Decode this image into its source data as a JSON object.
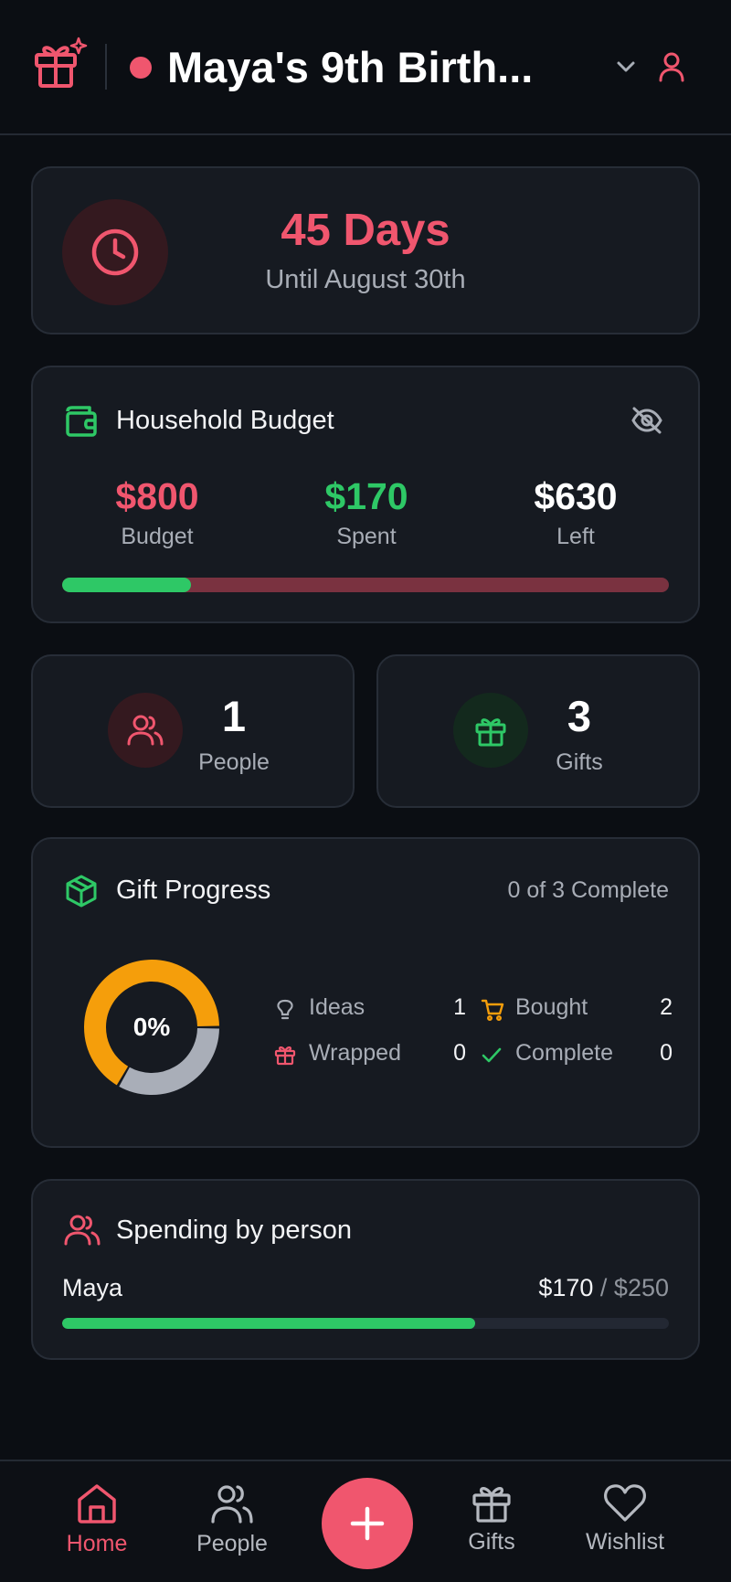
{
  "header": {
    "event_title": "Maya's 9th Birth...",
    "event_color": "#f0566e"
  },
  "countdown": {
    "days": "45 Days",
    "until": "Until August 30th"
  },
  "budget": {
    "title": "Household Budget",
    "budget_value": "$800",
    "budget_label": "Budget",
    "spent_value": "$170",
    "spent_label": "Spent",
    "left_value": "$630",
    "left_label": "Left",
    "spent_fraction": 0.2125
  },
  "stats": {
    "people_count": "1",
    "people_label": "People",
    "gifts_count": "3",
    "gifts_label": "Gifts"
  },
  "gift_progress": {
    "title": "Gift Progress",
    "summary": "0 of 3 Complete",
    "percent_label": "0%",
    "legend": [
      {
        "name": "Ideas",
        "value": "1",
        "icon": "lightbulb-icon"
      },
      {
        "name": "Bought",
        "value": "2",
        "icon": "cart-icon"
      },
      {
        "name": "Wrapped",
        "value": "0",
        "icon": "gift-icon"
      },
      {
        "name": "Complete",
        "value": "0",
        "icon": "check-icon"
      }
    ],
    "donut_segments": [
      {
        "status": "Ideas",
        "count": 1,
        "color": "#a9aeb8"
      },
      {
        "status": "Bought",
        "count": 2,
        "color": "#f59e0b"
      }
    ]
  },
  "spending": {
    "title": "Spending by person",
    "people": [
      {
        "name": "Maya",
        "spent": "$170",
        "separator": " / ",
        "limit": "$250",
        "fraction": 0.68
      }
    ]
  },
  "nav": {
    "home": "Home",
    "people": "People",
    "gifts": "Gifts",
    "wishlist": "Wishlist"
  },
  "colors": {
    "accent": "#f0566e",
    "success": "#2ec866",
    "warning": "#f59e0b",
    "background": "#0b0e13",
    "card": "#161a21"
  }
}
